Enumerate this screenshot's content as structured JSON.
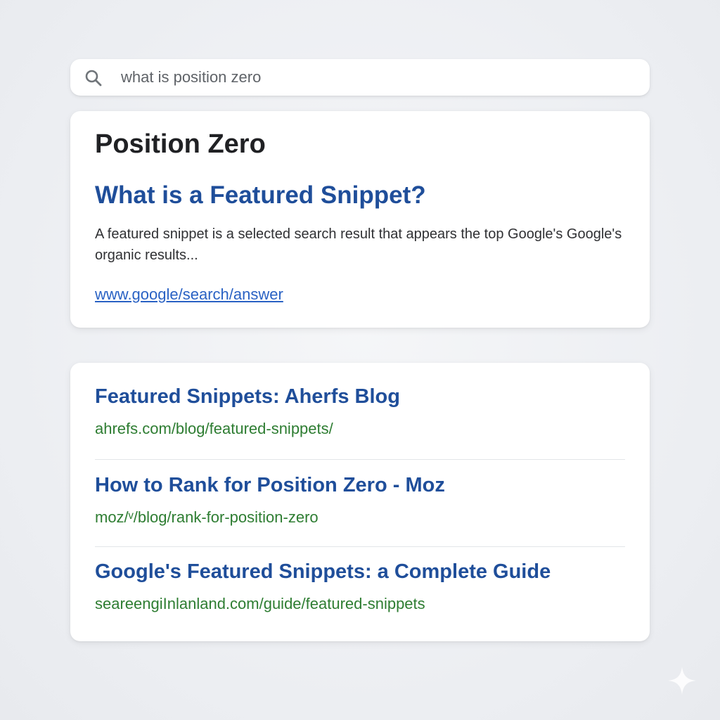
{
  "search": {
    "query": "what is position zero",
    "icon": "search-icon"
  },
  "featured_snippet": {
    "heading": "Position Zero",
    "title": "What is a Featured Snippet?",
    "text": "A featured snippet is a selected search result that appears the top Google's Google's organic results...",
    "url": "www.google/search/answer"
  },
  "results": [
    {
      "title": "Featured Snippets: Aherfs Blog",
      "url": "ahrefs.com/blog/featured-snippets/"
    },
    {
      "title": "How to Rank for Position Zero - Moz",
      "url": "moz/ᵛ/blog/rank-for-position-zero"
    },
    {
      "title": "Google's Featured Snippets: a Complete Guide",
      "url": "seareengiInlanland.com/guide/featured-snippets"
    }
  ],
  "colors": {
    "link_title": "#1f4e9a",
    "link_url": "#2a62c4",
    "result_url": "#2e7d32",
    "heading": "#202124"
  }
}
